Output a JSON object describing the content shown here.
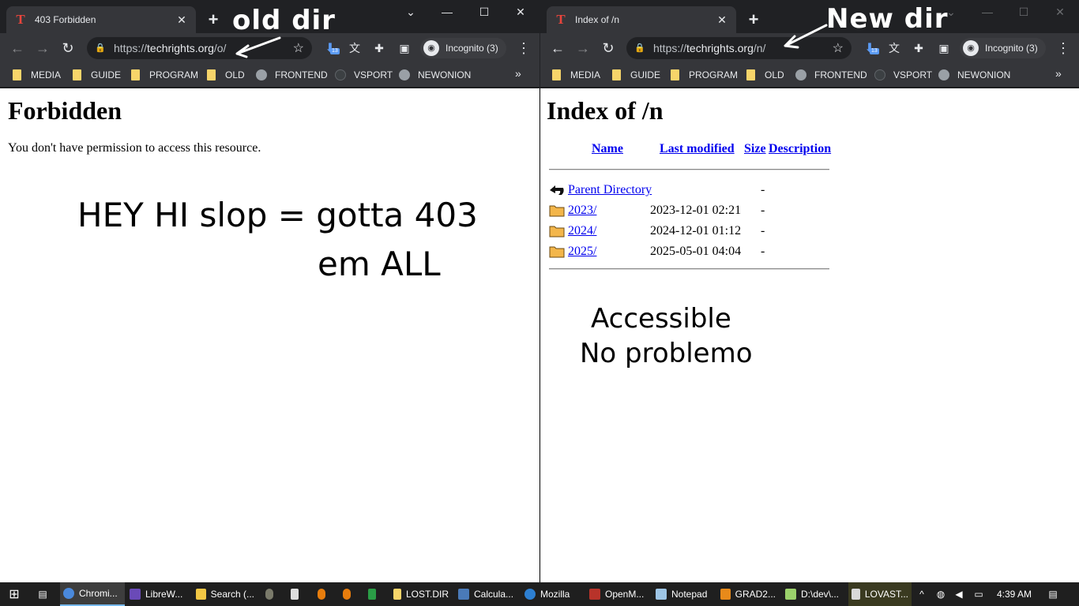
{
  "left_window": {
    "tab_title": "403 Forbidden",
    "tab_favicon": "T",
    "url_prefix": "https://",
    "url_host": "techrights.org",
    "url_path": "/o/",
    "incognito_label": "Incognito (3)",
    "download_badge": "13",
    "bookmarks": [
      "MEDIA",
      "GUIDE",
      "PROGRAM",
      "OLD",
      "FRONTEND",
      "VSPORT",
      "NEWONION"
    ],
    "page_heading": "Forbidden",
    "page_text": "You don't have permission to access this resource.",
    "annotation_title": "old dir",
    "annotation_note_line1": "HEY HI slop = gotta 403",
    "annotation_note_line2": "em ALL"
  },
  "right_window": {
    "tab_title": "Index of /n",
    "tab_favicon": "T",
    "url_prefix": "https://",
    "url_host": "techrights.org",
    "url_path": "/n/",
    "incognito_label": "Incognito (3)",
    "download_badge": "13",
    "bookmarks": [
      "MEDIA",
      "GUIDE",
      "PROGRAM",
      "OLD",
      "FRONTEND",
      "VSPORT",
      "NEWONION"
    ],
    "page_heading": "Index of /n",
    "table_headers": [
      "Name",
      "Last modified",
      "Size",
      "Description"
    ],
    "rows": [
      {
        "name": "Parent Directory",
        "date": "",
        "size": "-",
        "icon": "back-icon"
      },
      {
        "name": "2023/",
        "date": "2023-12-01 02:21",
        "size": "-",
        "icon": "folder-icon"
      },
      {
        "name": "2024/",
        "date": "2024-12-01 01:12",
        "size": "-",
        "icon": "folder-icon"
      },
      {
        "name": "2025/",
        "date": "2025-05-01 04:04",
        "size": "-",
        "icon": "folder-icon"
      }
    ],
    "annotation_title": "New dir",
    "annotation_note_line1": "Accessible",
    "annotation_note_line2": "No problemo"
  },
  "taskbar": {
    "items": [
      "Chromi...",
      "LibreW...",
      "Search (...",
      "LOST.DIR",
      "Calcula...",
      "Mozilla",
      "OpenM...",
      "Notepad",
      "GRAD2...",
      "D:\\dev\\...",
      "LOVAST..."
    ],
    "clock": "4:39 AM"
  },
  "colors": {
    "chrome_dark": "#202124",
    "toolbar": "#35363a",
    "link": "#0000ee",
    "folder_bookmark": "#f7d56a"
  }
}
